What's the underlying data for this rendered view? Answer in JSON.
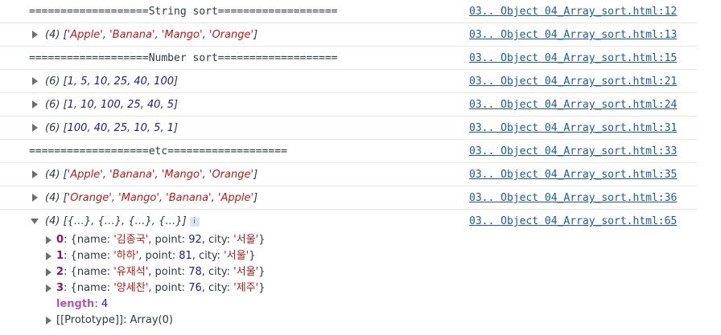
{
  "rows": [
    {
      "kind": "text",
      "text": "===================String sort===================",
      "source": "03.. Object 04_Array_sort.html:12"
    },
    {
      "kind": "array",
      "count": "(4)",
      "values": [
        "Apple",
        "Banana",
        "Mango",
        "Orange"
      ],
      "type": "string",
      "source": "03.. Object 04_Array_sort.html:13"
    },
    {
      "kind": "text",
      "text": "===================Number sort===================",
      "source": "03.. Object 04_Array_sort.html:15"
    },
    {
      "kind": "array",
      "count": "(6)",
      "values": [
        "1",
        "5",
        "10",
        "25",
        "40",
        "100"
      ],
      "type": "number",
      "source": "03.. Object 04_Array_sort.html:21"
    },
    {
      "kind": "array",
      "count": "(6)",
      "values": [
        "1",
        "10",
        "100",
        "25",
        "40",
        "5"
      ],
      "type": "number",
      "source": "03.. Object 04_Array_sort.html:24"
    },
    {
      "kind": "array",
      "count": "(6)",
      "values": [
        "100",
        "40",
        "25",
        "10",
        "5",
        "1"
      ],
      "type": "number",
      "source": "03.. Object 04_Array_sort.html:31"
    },
    {
      "kind": "text",
      "text": "===================etc===================",
      "source": "03.. Object 04_Array_sort.html:33"
    },
    {
      "kind": "array",
      "count": "(4)",
      "values": [
        "Apple",
        "Banana",
        "Mango",
        "Orange"
      ],
      "type": "string",
      "source": "03.. Object 04_Array_sort.html:35"
    },
    {
      "kind": "array",
      "count": "(4)",
      "values": [
        "Orange",
        "Mango",
        "Banana",
        "Apple"
      ],
      "type": "string",
      "source": "03.. Object 04_Array_sort.html:36"
    }
  ],
  "expanded": {
    "count": "(4)",
    "summary": "[{…}, {…}, {…}, {…}]",
    "info_badge": "i",
    "source": "03.. Object 04_Array_sort.html:65",
    "items": [
      {
        "index": "0",
        "name": "김종국",
        "point": "92",
        "city": "서울"
      },
      {
        "index": "1",
        "name": "하하",
        "point": "81",
        "city": "서울"
      },
      {
        "index": "2",
        "name": "유재석",
        "point": "78",
        "city": "서울"
      },
      {
        "index": "3",
        "name": "양세찬",
        "point": "76",
        "city": "제주"
      }
    ],
    "length_label": "length",
    "length_value": "4",
    "prototype_label": "[[Prototype]]",
    "prototype_value": "Array(0)"
  },
  "colors": {
    "string": "#c41a16",
    "number": "#1a1aa6",
    "link": "#1a5ba6",
    "separator": "#e6e6e6"
  }
}
